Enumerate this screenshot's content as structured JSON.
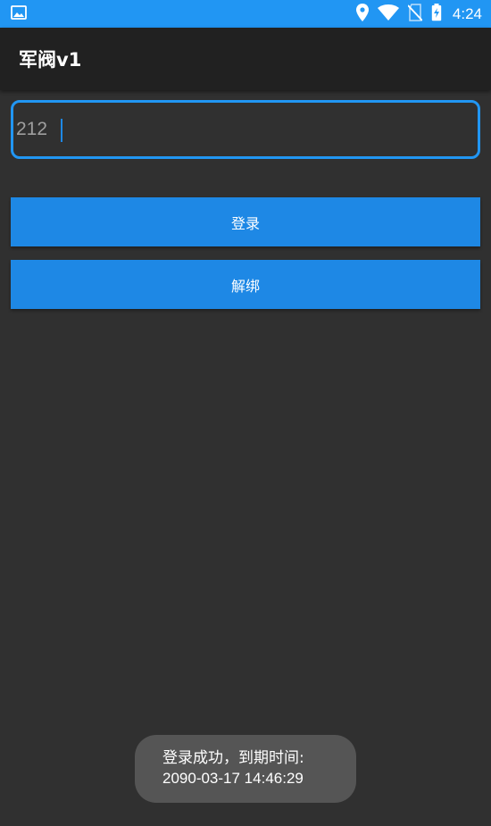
{
  "status_bar": {
    "time": "4:24",
    "background_color": "#2196f3",
    "icons": [
      "image-notification-icon",
      "location-icon",
      "wifi-icon",
      "no-sim-icon",
      "battery-charging-icon"
    ]
  },
  "app_bar": {
    "title": "军阀v1"
  },
  "form": {
    "code_value": "212",
    "accent_color": "#2196f3"
  },
  "buttons": {
    "login_label": "登录",
    "unbind_label": "解绑",
    "color": "#1e88e5"
  },
  "toast": {
    "line1": "登录成功，到期时间:",
    "line2": "2090-03-17 14:46:29"
  }
}
